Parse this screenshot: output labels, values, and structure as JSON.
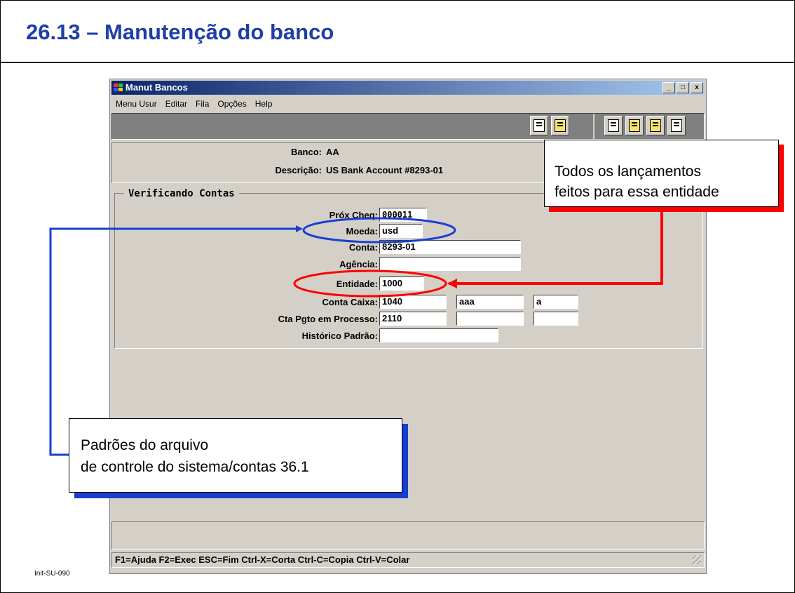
{
  "slide": {
    "title": "26.13 – Manutenção do banco",
    "footer_id": "Init-SU-090"
  },
  "window": {
    "title": "Manut Bancos",
    "controls": [
      "_",
      "□",
      "x"
    ]
  },
  "menu": [
    "Menu Usur",
    "Editar",
    "Fila",
    "Opções",
    "Help"
  ],
  "toolbar": {
    "icons": [
      "copy-icon",
      "paste-icon",
      "help-query-icon",
      "help-icon",
      "export-icon",
      "edit-icon"
    ]
  },
  "header": {
    "banco_label": "Banco:",
    "banco_value": "AA",
    "descricao_label": "Descrição:",
    "descricao_value": "US Bank Account #8293-01"
  },
  "group": {
    "title": "Verificando Contas",
    "prox_cheq_label": "Próx Cheq:",
    "prox_cheq_value": "000011",
    "moeda_label": "Moeda:",
    "moeda_value": "usd",
    "conta_label": "Conta:",
    "conta_value": "8293-01",
    "agencia_label": "Agência:",
    "agencia_value": "",
    "entidade_label": "Entidade:",
    "entidade_value": "1000",
    "conta_caixa_label": "Conta Caixa:",
    "conta_caixa_values": [
      "1040",
      "aaa",
      "a"
    ],
    "cta_pgto_label": "Cta Pgto em Processo:",
    "cta_pgto_values": [
      "2110",
      "",
      ""
    ],
    "historico_label": "Histórico Padrão:",
    "historico_value": ""
  },
  "status": {
    "text": "F1=Ajuda F2=Exec ESC=Fim Ctrl-X=Corta Ctrl-C=Copia Ctrl-V=Colar"
  },
  "callouts": {
    "red": [
      "Todos os lançamentos",
      "feitos para essa entidade"
    ],
    "blue": [
      "Padrões do arquivo",
      "de controle do sistema/contas 36.1"
    ]
  },
  "colors": {
    "title_blue": "#1f3ea8",
    "annotation_red": "#ff0000",
    "annotation_blue": "#1a3fd0",
    "window_gray": "#d4d0c8"
  }
}
